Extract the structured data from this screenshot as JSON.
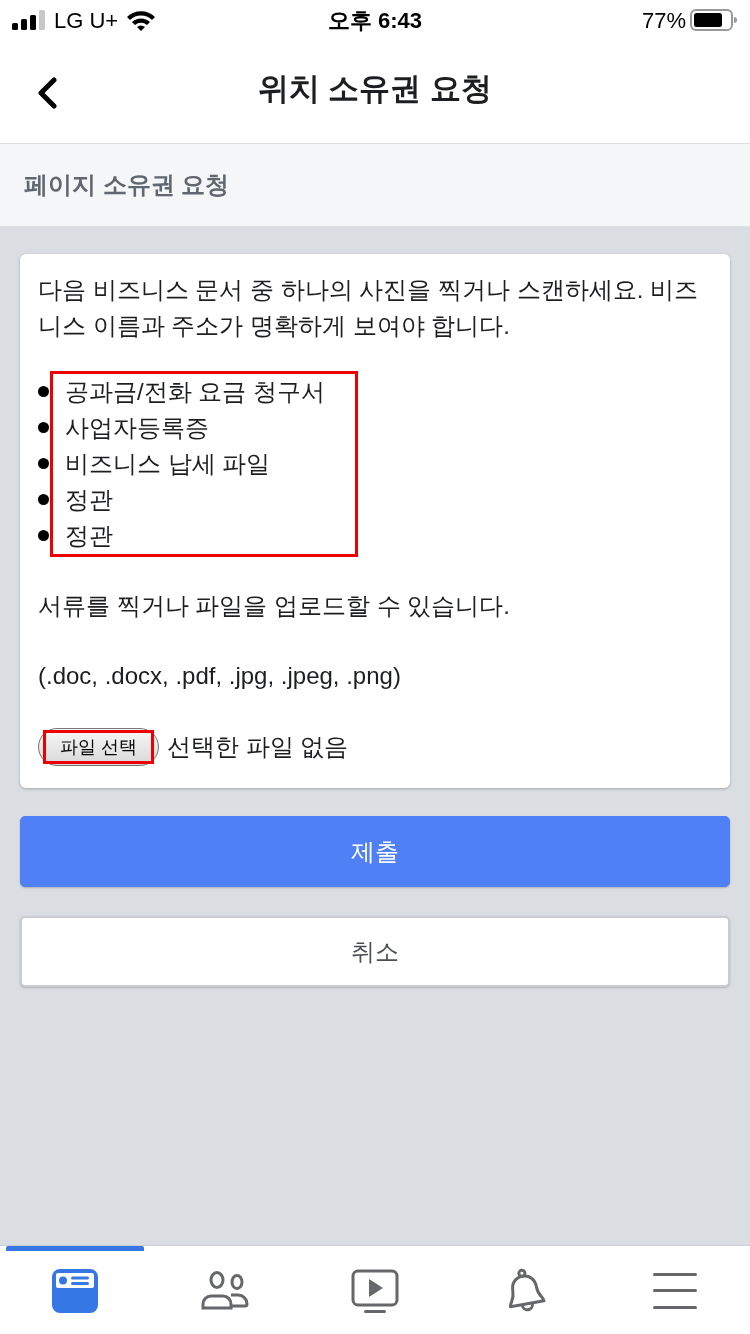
{
  "status_bar": {
    "carrier": "LG U+",
    "time": "오후 6:43",
    "battery": "77%"
  },
  "header": {
    "title": "위치 소유권 요청"
  },
  "section": {
    "title": "페이지 소유권 요청"
  },
  "card": {
    "intro": "다음 비즈니스 문서 중 하나의 사진을 찍거나 스캔하세요. 비즈니스 이름과 주소가 명확하게 보여야 합니다.",
    "documents": {
      "highlighted": true,
      "items": [
        "공과금/전화 요금 청구서",
        "사업자등록증",
        "비즈니스 납세 파일",
        "정관",
        "정관"
      ]
    },
    "upload_note": "서류를 찍거나 파일을 업로드할 수 있습니다.",
    "formats": "(.doc, .docx, .pdf, .jpg, .jpeg, .png)",
    "file_input": {
      "button": "파일 선택",
      "highlighted": true,
      "status": "선택한 파일 없음"
    }
  },
  "buttons": [
    {
      "label": "제출",
      "kind": "primary"
    },
    {
      "label": "취소",
      "kind": "secondary"
    }
  ],
  "tab_bar": [
    {
      "kind": "news_feed",
      "selected": true
    },
    {
      "kind": "friends",
      "selected": false
    },
    {
      "kind": "video",
      "selected": false
    },
    {
      "kind": "notifications",
      "selected": false
    },
    {
      "kind": "menu",
      "selected": false
    }
  ]
}
